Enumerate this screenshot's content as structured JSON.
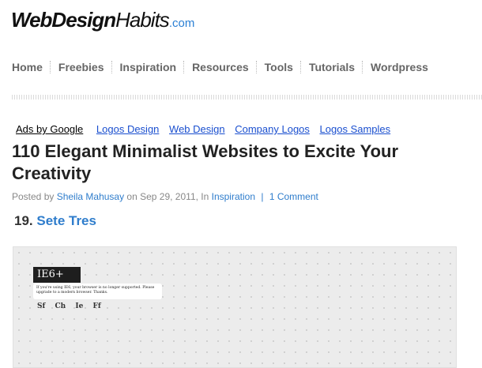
{
  "site": {
    "logo_main": "WebDesign",
    "logo_habits": "Habits",
    "logo_tld": ".com"
  },
  "nav": [
    "Home",
    "Freebies",
    "Inspiration",
    "Resources",
    "Tools",
    "Tutorials",
    "Wordpress"
  ],
  "ads": {
    "label": "Ads by Google",
    "links": [
      "Logos Design",
      "Web Design",
      "Company Logos",
      "Logos Samples"
    ]
  },
  "article": {
    "title": "110 Elegant Minimalist Websites to Excite Your Creativity",
    "meta": {
      "posted_by": "Posted by ",
      "author": "Sheila Mahusay",
      "on_date": " on Sep 29, 2011, In ",
      "category": "Inspiration",
      "pipe": "|",
      "comments": "1 Comment"
    },
    "item_number": "19. ",
    "item_name": "Sete Tres"
  },
  "preview": {
    "badge": "IE6+",
    "message": "If you're using IE6, your browser is no longer supported. Please upgrade to a modern browser. Thanks.",
    "browsers": [
      "Sf",
      "Ch",
      "Ie",
      "Ff"
    ]
  },
  "colors": {
    "link": "#2f7dcc",
    "ad_link": "#1a4fcf",
    "logo_tld": "#2a7fd4"
  }
}
